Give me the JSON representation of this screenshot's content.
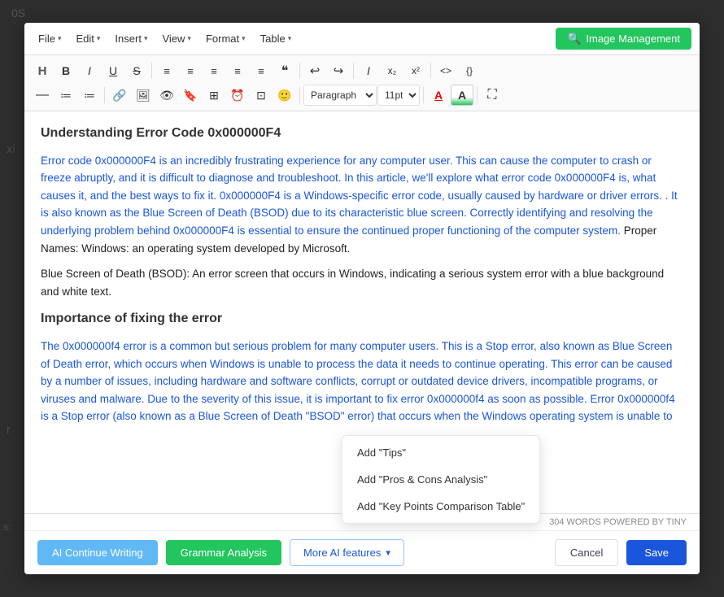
{
  "modal": {
    "menu": {
      "file": "File",
      "edit": "Edit",
      "insert": "Insert",
      "view": "View",
      "format": "Format",
      "table": "Table",
      "image_management": "Image Management"
    },
    "toolbar1": {
      "buttons": [
        "H",
        "B",
        "I",
        "U",
        "S",
        "≡",
        "≡",
        "≡",
        "≡",
        "≡",
        "❝",
        "↩",
        "↪",
        "𝐼",
        "x₂",
        "x²",
        "<>",
        "{}"
      ]
    },
    "toolbar2": {
      "buttons": [
        "—",
        "≔",
        "≔",
        "🔗",
        "🖼",
        "👁",
        "🔖",
        "⊞",
        "⏰",
        "⊡",
        "🙂"
      ],
      "paragraph": "Paragraph",
      "font_size": "11pt",
      "font_color": "A",
      "bg_color": "A",
      "fullscreen": "⛶"
    },
    "content": {
      "heading": "Understanding Error Code 0x000000F4",
      "paragraphs": [
        "Error code 0x000000F4 is an incredibly frustrating experience for any computer user. This can cause the computer to crash or freeze abruptly, and it is difficult to diagnose and troubleshoot. In this article, we'll explore what error code 0x000000F4 is, what causes it, and the best ways to fix it. 0x000000F4 is a Windows-specific error code, usually caused by hardware or driver errors. . It is also known as the Blue Screen of Death (BSOD) due to its characteristic blue screen. Correctly identifying and resolving the underlying problem behind 0x000000F4 is essential to ensure the continued proper functioning of the computer system. Proper Names: Windows: an operating system developed by Microsoft.",
        "Blue Screen of Death (BSOD): An error screen that occurs in Windows, indicating a serious system error with a blue background and white text.",
        "Importance of fixing the error",
        "The 0x000000f4 error is a common but serious problem for many computer users. This is a Stop error, also known as Blue Screen of Death error, which occurs when Windows is unable to process the data it needs to continue operating. This error can be caused by a number of issues, including hardware and software conflicts, corrupt or outdated device drivers, incompatible programs, or viruses and malware. Due to the severity of this issue, it is important to fix error 0x000000f4 as soon as possible. Error 0x000000f4 is a Stop error (also known as a Blue Screen of Death \"BSOD\" error) that occurs when the Windows operating system is unable to"
      ]
    },
    "word_count": "304 WORDS POWERED BY TINY",
    "footer": {
      "ai_continue": "AI Continue Writing",
      "grammar": "Grammar Analysis",
      "more_ai": "More AI features",
      "cancel": "Cancel",
      "save": "Save"
    },
    "dropdown": {
      "items": [
        "Add \"Tips\"",
        "Add \"Pros & Cons Analysis\"",
        "Add \"Key Points Comparison Table\""
      ]
    }
  },
  "background": {
    "text1": "0S",
    "text2": "xi",
    "text3": "r",
    "text4": "s:"
  }
}
